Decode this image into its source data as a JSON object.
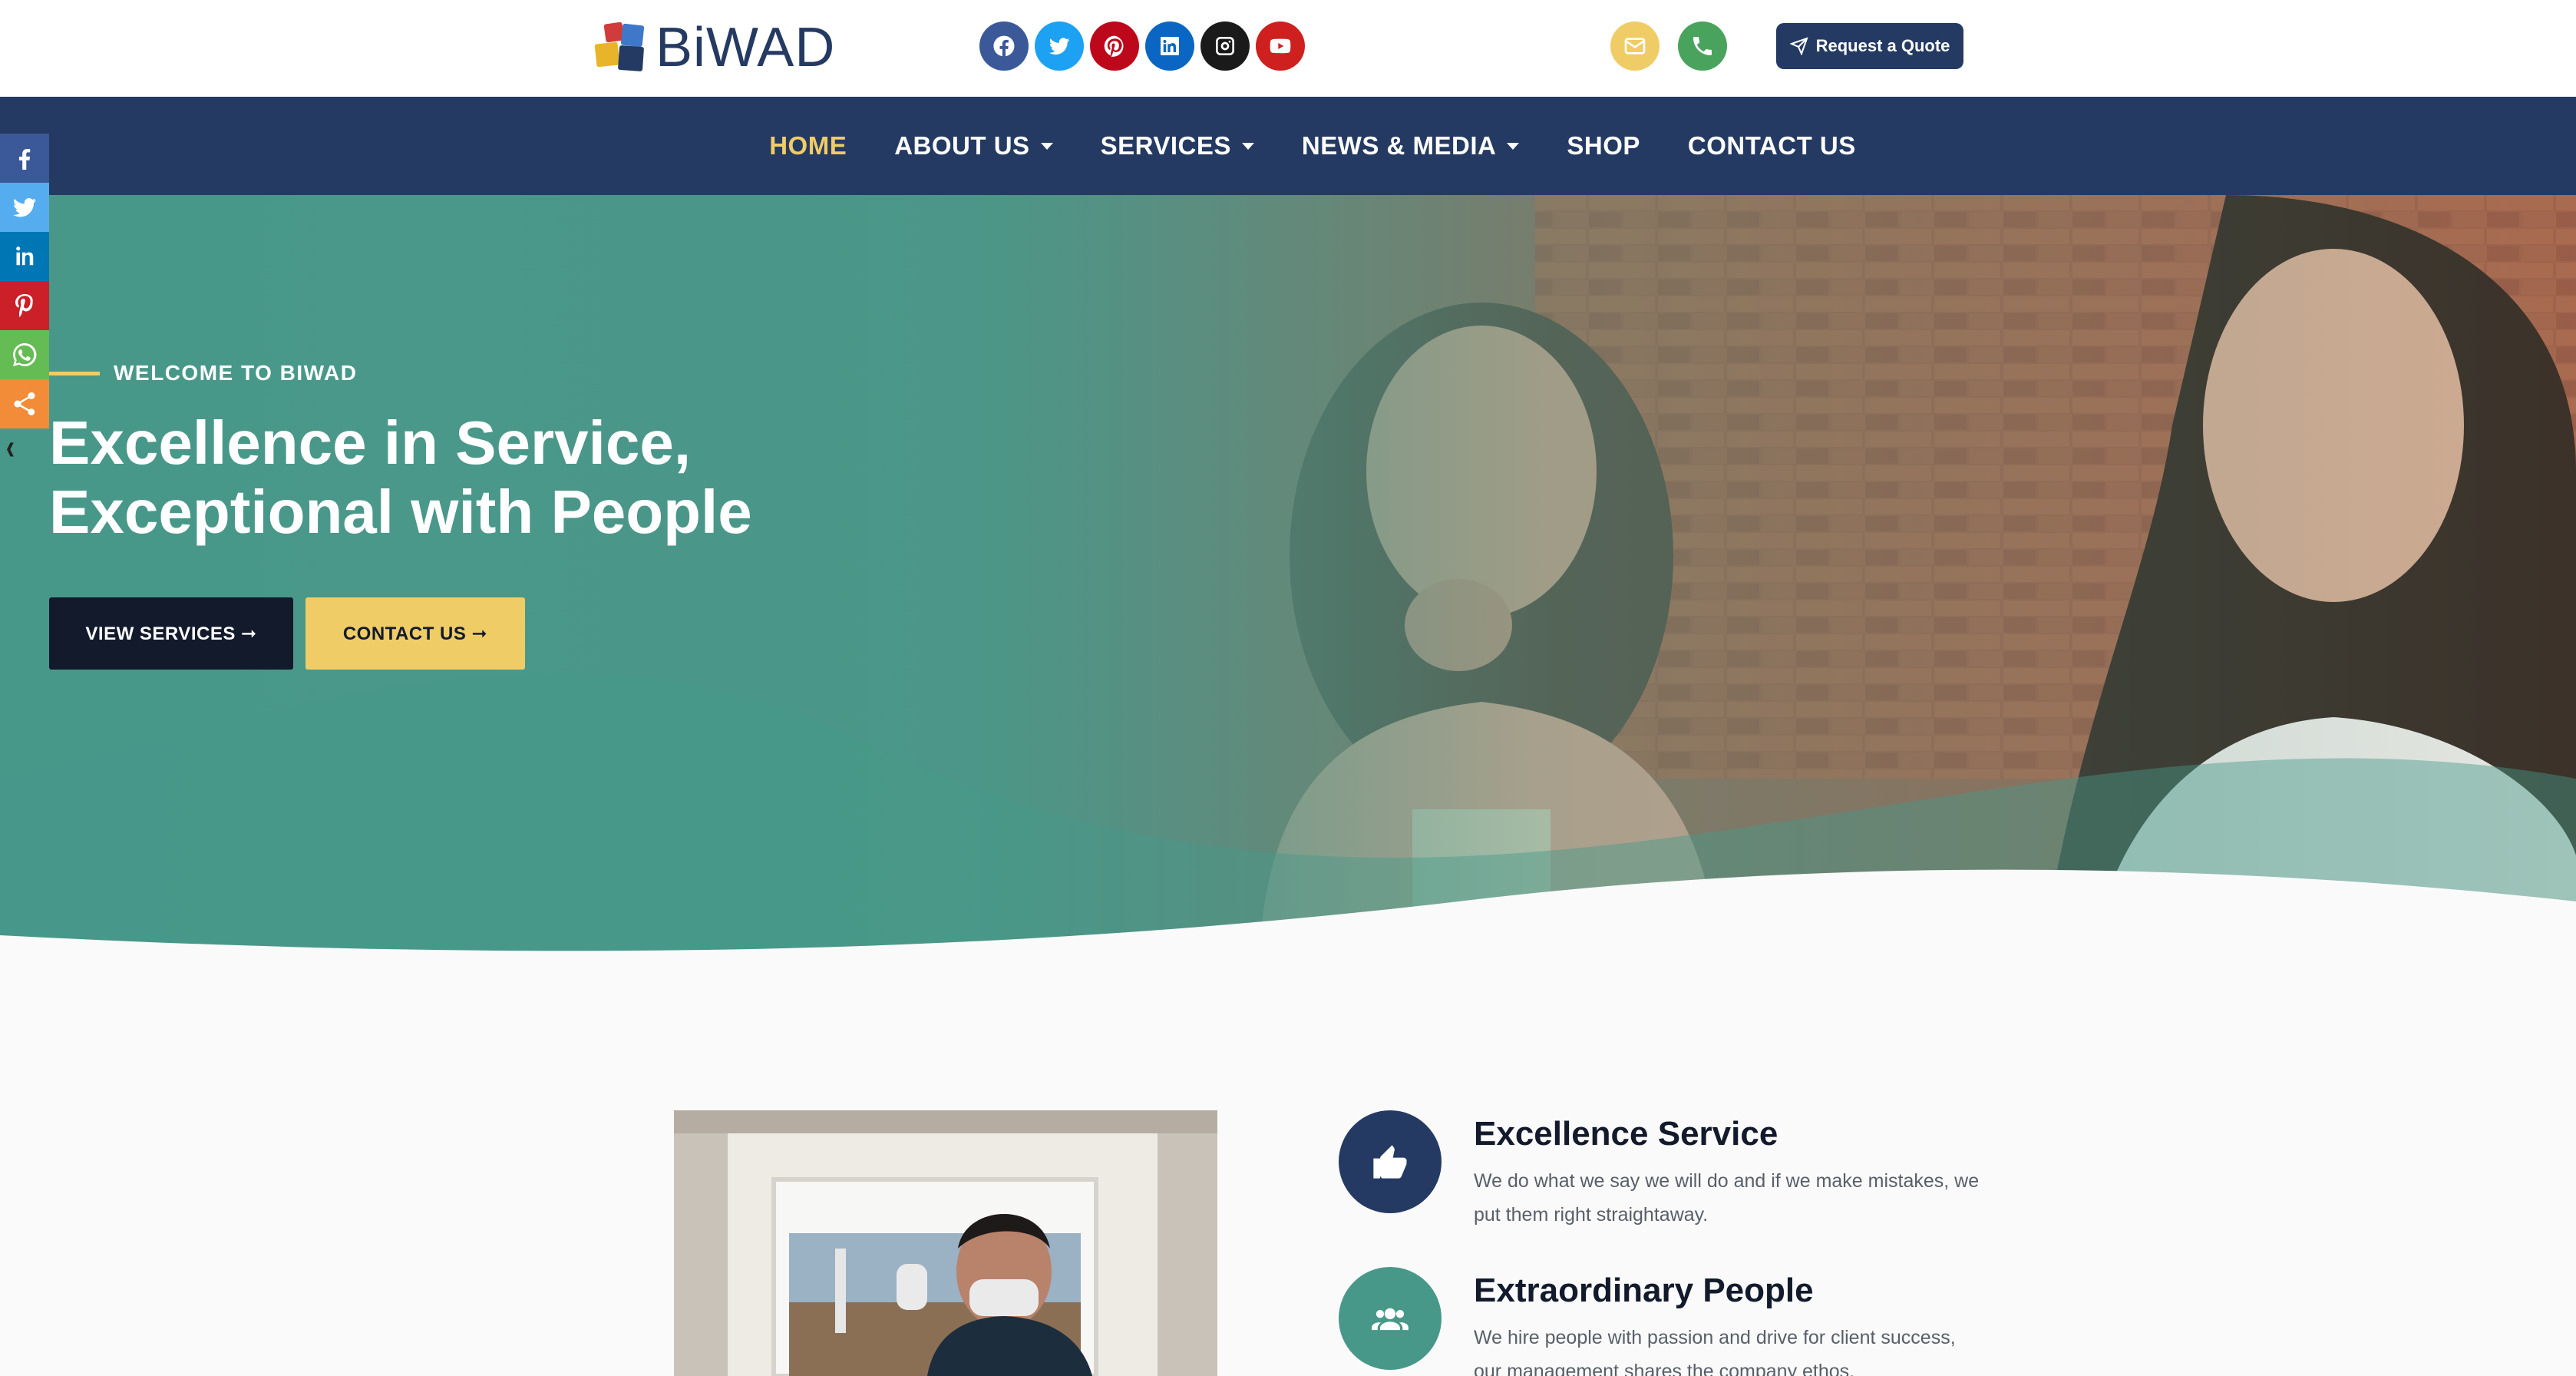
{
  "brand": {
    "name": "BiWAD",
    "logo_icon": "four-square-blocks-logo"
  },
  "social_links": [
    {
      "name": "facebook",
      "icon": "facebook-icon",
      "color": "#3b5998"
    },
    {
      "name": "twitter",
      "icon": "twitter-icon",
      "color": "#1da1f2"
    },
    {
      "name": "pinterest",
      "icon": "pinterest-icon",
      "color": "#bd081c"
    },
    {
      "name": "linkedin",
      "icon": "linkedin-icon",
      "color": "#0a66c2"
    },
    {
      "name": "instagram",
      "icon": "instagram-icon",
      "color": "#1a1a1a"
    },
    {
      "name": "youtube",
      "icon": "youtube-icon",
      "color": "#cd201f"
    }
  ],
  "header_actions": {
    "email_icon": "envelope-icon",
    "phone_icon": "phone-icon",
    "quote_label": "Request a Quote",
    "quote_icon": "paper-plane-icon"
  },
  "nav": {
    "items": [
      {
        "label": "HOME",
        "active": true,
        "dropdown": false
      },
      {
        "label": "ABOUT US",
        "active": false,
        "dropdown": true
      },
      {
        "label": "SERVICES",
        "active": false,
        "dropdown": true
      },
      {
        "label": "NEWS & MEDIA",
        "active": false,
        "dropdown": true
      },
      {
        "label": "SHOP",
        "active": false,
        "dropdown": false
      },
      {
        "label": "CONTACT US",
        "active": false,
        "dropdown": false
      }
    ]
  },
  "share_bar": [
    {
      "name": "facebook",
      "icon": "facebook-icon",
      "color": "#3b5998"
    },
    {
      "name": "twitter",
      "icon": "twitter-icon",
      "color": "#55acee"
    },
    {
      "name": "linkedin",
      "icon": "linkedin-icon",
      "color": "#0077b5"
    },
    {
      "name": "pinterest",
      "icon": "pinterest-icon",
      "color": "#cb2027"
    },
    {
      "name": "whatsapp",
      "icon": "whatsapp-icon",
      "color": "#65bc54"
    },
    {
      "name": "more",
      "icon": "share-icon",
      "color": "#f28c38"
    }
  ],
  "hero": {
    "eyebrow": "WELCOME TO BIWAD",
    "headline_line1": "Excellence in Service,",
    "headline_line2": "Exceptional with People",
    "btn_services": "VIEW SERVICES ➞",
    "btn_contact": "CONTACT US ➞"
  },
  "features": [
    {
      "title": "Excellence Service",
      "description": "We do what we say we will do and if we make mistakes, we put them right straightaway.",
      "icon": "thumbs-up-icon",
      "color": "#243a63"
    },
    {
      "title": "Extraordinary People",
      "description": "We hire people with passion and drive for client success, our management shares the company ethos.",
      "icon": "users-icon",
      "color": "#48988a"
    }
  ],
  "colors": {
    "navy": "#243a63",
    "teal": "#48988a",
    "gold": "#f0cc67",
    "dark": "#121a2c"
  }
}
